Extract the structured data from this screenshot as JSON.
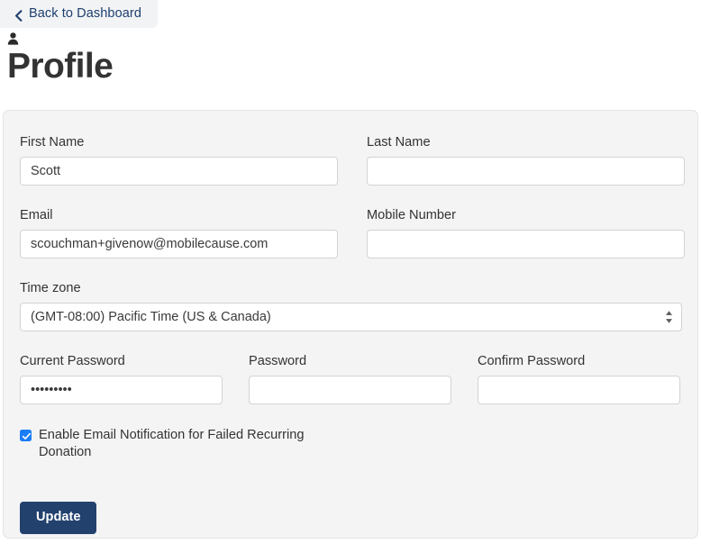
{
  "header": {
    "back_label": "Back to Dashboard",
    "back_icon": "chevron-left-icon",
    "title": "Profile",
    "title_icon": "user-icon"
  },
  "form": {
    "first_name": {
      "label": "First Name",
      "value": "Scott",
      "placeholder": ""
    },
    "last_name": {
      "label": "Last Name",
      "value": "",
      "placeholder": ""
    },
    "email": {
      "label": "Email",
      "value": "scouchman+givenow@mobilecause.com",
      "placeholder": ""
    },
    "mobile_number": {
      "label": "Mobile Number",
      "value": "",
      "placeholder": ""
    },
    "time_zone": {
      "label": "Time zone",
      "selected": "(GMT-08:00) Pacific Time (US & Canada)"
    },
    "current_password": {
      "label": "Current Password",
      "value": "•••••••••",
      "placeholder": ""
    },
    "password": {
      "label": "Password",
      "value": "",
      "placeholder": ""
    },
    "confirm_password": {
      "label": "Confirm Password",
      "value": "",
      "placeholder": ""
    },
    "email_notification": {
      "label": "Enable Email Notification for Failed Recurring Donation",
      "checked": true,
      "icon": "check-icon"
    },
    "submit": {
      "label": "Update"
    }
  },
  "colors": {
    "accent_link": "#1d3f6e",
    "button_primary": "#23416d",
    "checkbox_checked": "#1b7ef7",
    "card_background": "#f4f4f5",
    "card_border": "#e3e3e5",
    "input_border": "#d3d3d6",
    "text_primary": "#333333",
    "page_background": "#ffffff"
  }
}
